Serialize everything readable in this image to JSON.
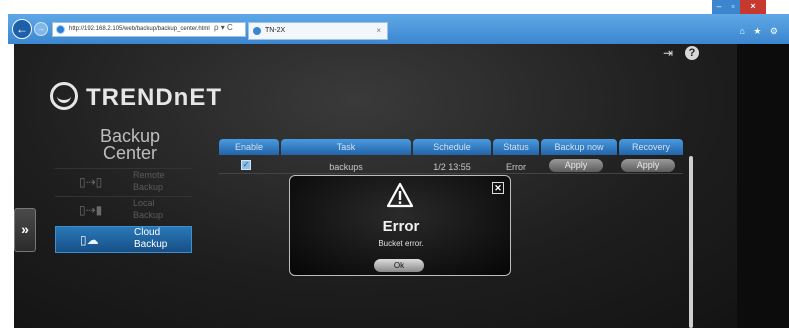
{
  "browser": {
    "back_icon": "←",
    "forward_icon": "→",
    "address": "http://192.168.2.105/web/backup/backup_center.html",
    "address_tools": "ρ ▾ C",
    "tab_title": "TN-2X",
    "tab_close": "×",
    "window_controls": {
      "minimize": "–",
      "maximize": "▫",
      "close": "×"
    },
    "toolbar_icons": "⌂ ★ ⚙"
  },
  "header": {
    "logo_text": "TRENDnET",
    "logout_icon": "⇥",
    "help_icon": "?"
  },
  "sidebar": {
    "expand_label": "»",
    "title_line1": "Backup",
    "title_line2": "Center",
    "items": [
      {
        "label_line1": "Remote",
        "label_line2": "Backup",
        "icon": "▯⇢▯",
        "active": false
      },
      {
        "label_line1": "Local",
        "label_line2": "Backup",
        "icon": "▯⇢▮",
        "active": false
      },
      {
        "label_line1": "Cloud",
        "label_line2": "Backup",
        "icon": "▯☁",
        "active": true
      }
    ]
  },
  "table": {
    "columns": [
      "Enable",
      "Task",
      "Schedule",
      "Status",
      "Backup now",
      "Recovery"
    ],
    "rows": [
      {
        "enable_check": "✓",
        "task": "backups",
        "schedule": "1/2 13:55",
        "status": "Error",
        "backup_now": "Apply",
        "recovery": "Apply"
      }
    ]
  },
  "dialog": {
    "title": "Error",
    "message": "Bucket error.",
    "ok_label": "Ok",
    "close_label": "✕"
  }
}
